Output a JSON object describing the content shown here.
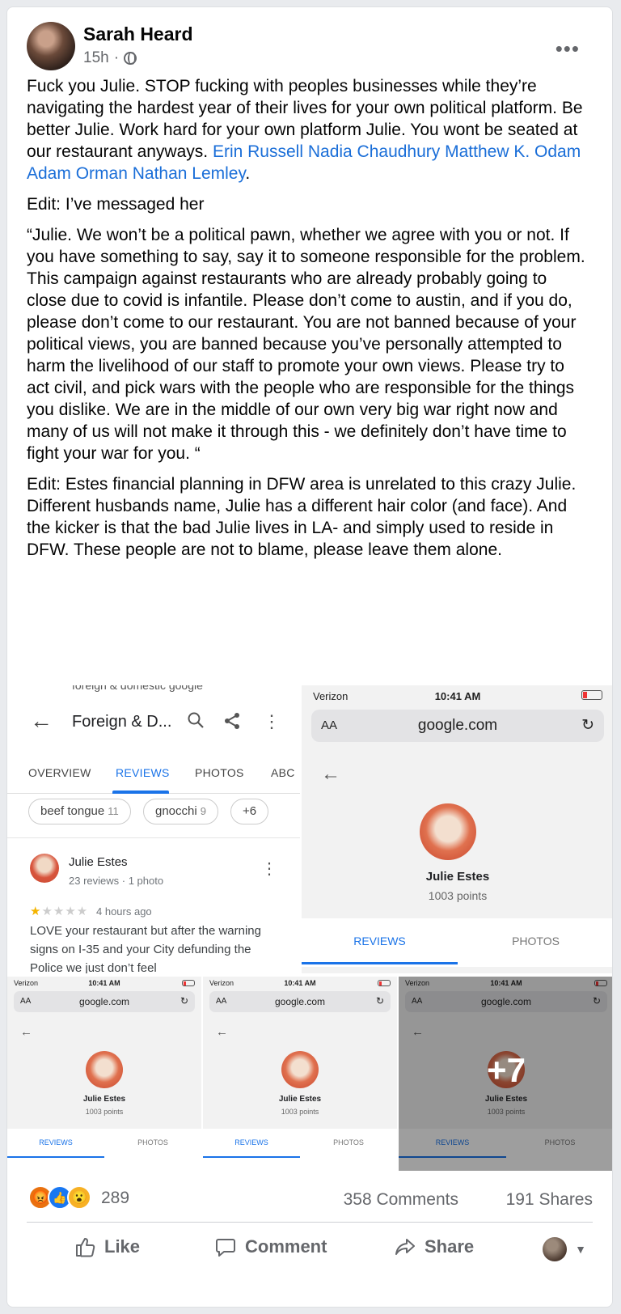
{
  "post": {
    "author": "Sarah Heard",
    "time": "15h",
    "time_sep": "·",
    "paragraphs": {
      "p1_text": "Fuck you Julie. STOP fucking with peoples businesses while they’re navigating the hardest year of their lives for your own political platform. Be better Julie. Work hard for your own platform Julie. You wont be seated at our restaurant anyways. ",
      "mentions": [
        "Erin Russell",
        "Nadia Chaudhury",
        "Matthew K. Odam",
        "Adam Orman",
        "Nathan Lemley"
      ],
      "p1_end": ".",
      "p2": "Edit: I’ve messaged her",
      "p3": "“Julie. We won’t be a political pawn, whether we agree with you or not. If you have something to say, say it to someone responsible for the problem. This campaign against restaurants who are already probably going to close due to covid is infantile. Please don’t come to austin, and if you do, please don’t come to our restaurant. You are not banned because of your political views, you are banned because you’ve personally attempted to harm the livelihood of our staff to promote your own views. Please try to act civil, and pick wars with the people who are responsible for the things you dislike. We are in the middle of our own very big war right now and many of us will not make it through this - we definitely don’t have time to fight your war for you. “",
      "p4a": "Edit: Estes financial planning in DFW area is unrelated to this crazy Julie.",
      "p4b": "Different husbands name, Julie has a different hair color (and face). And the kicker is that the bad Julie lives in LA- and simply used to reside in DFW. These people are not to blame, please leave them alone."
    }
  },
  "tile1": {
    "cut_text": "foreign & domestic google",
    "place_title": "Foreign & D...",
    "tabs": [
      "OVERVIEW",
      "REVIEWS",
      "PHOTOS",
      "ABC"
    ],
    "chips": [
      {
        "label": "beef tongue",
        "count": "11"
      },
      {
        "label": "gnocchi",
        "count": "9"
      },
      {
        "label": "+6",
        "count": ""
      }
    ],
    "reviewer": "Julie Estes",
    "reviewer_sub": "23 reviews · 1 photo",
    "rating": 1,
    "time_ago": "4 hours ago",
    "review_text": "LOVE your restaurant but after the warning signs on I-35 and your City defunding the Police we just don’t feel"
  },
  "phone": {
    "carrier": "Verizon",
    "time": "10:41 AM",
    "aa": "AA",
    "url": "google.com",
    "name": "Julie Estes",
    "points": "1003 points",
    "tab_reviews": "REVIEWS",
    "tab_photos": "PHOTOS"
  },
  "more_photos": "+7",
  "stats": {
    "reaction_count": "289",
    "comments": "358 Comments",
    "shares": "191 Shares"
  },
  "actions": {
    "like": "Like",
    "comment": "Comment",
    "share": "Share"
  },
  "colors": {
    "link": "#1a6ed8",
    "google_blue": "#1a73e8",
    "fb_blue": "#1877f2",
    "star": "#f4b400"
  }
}
